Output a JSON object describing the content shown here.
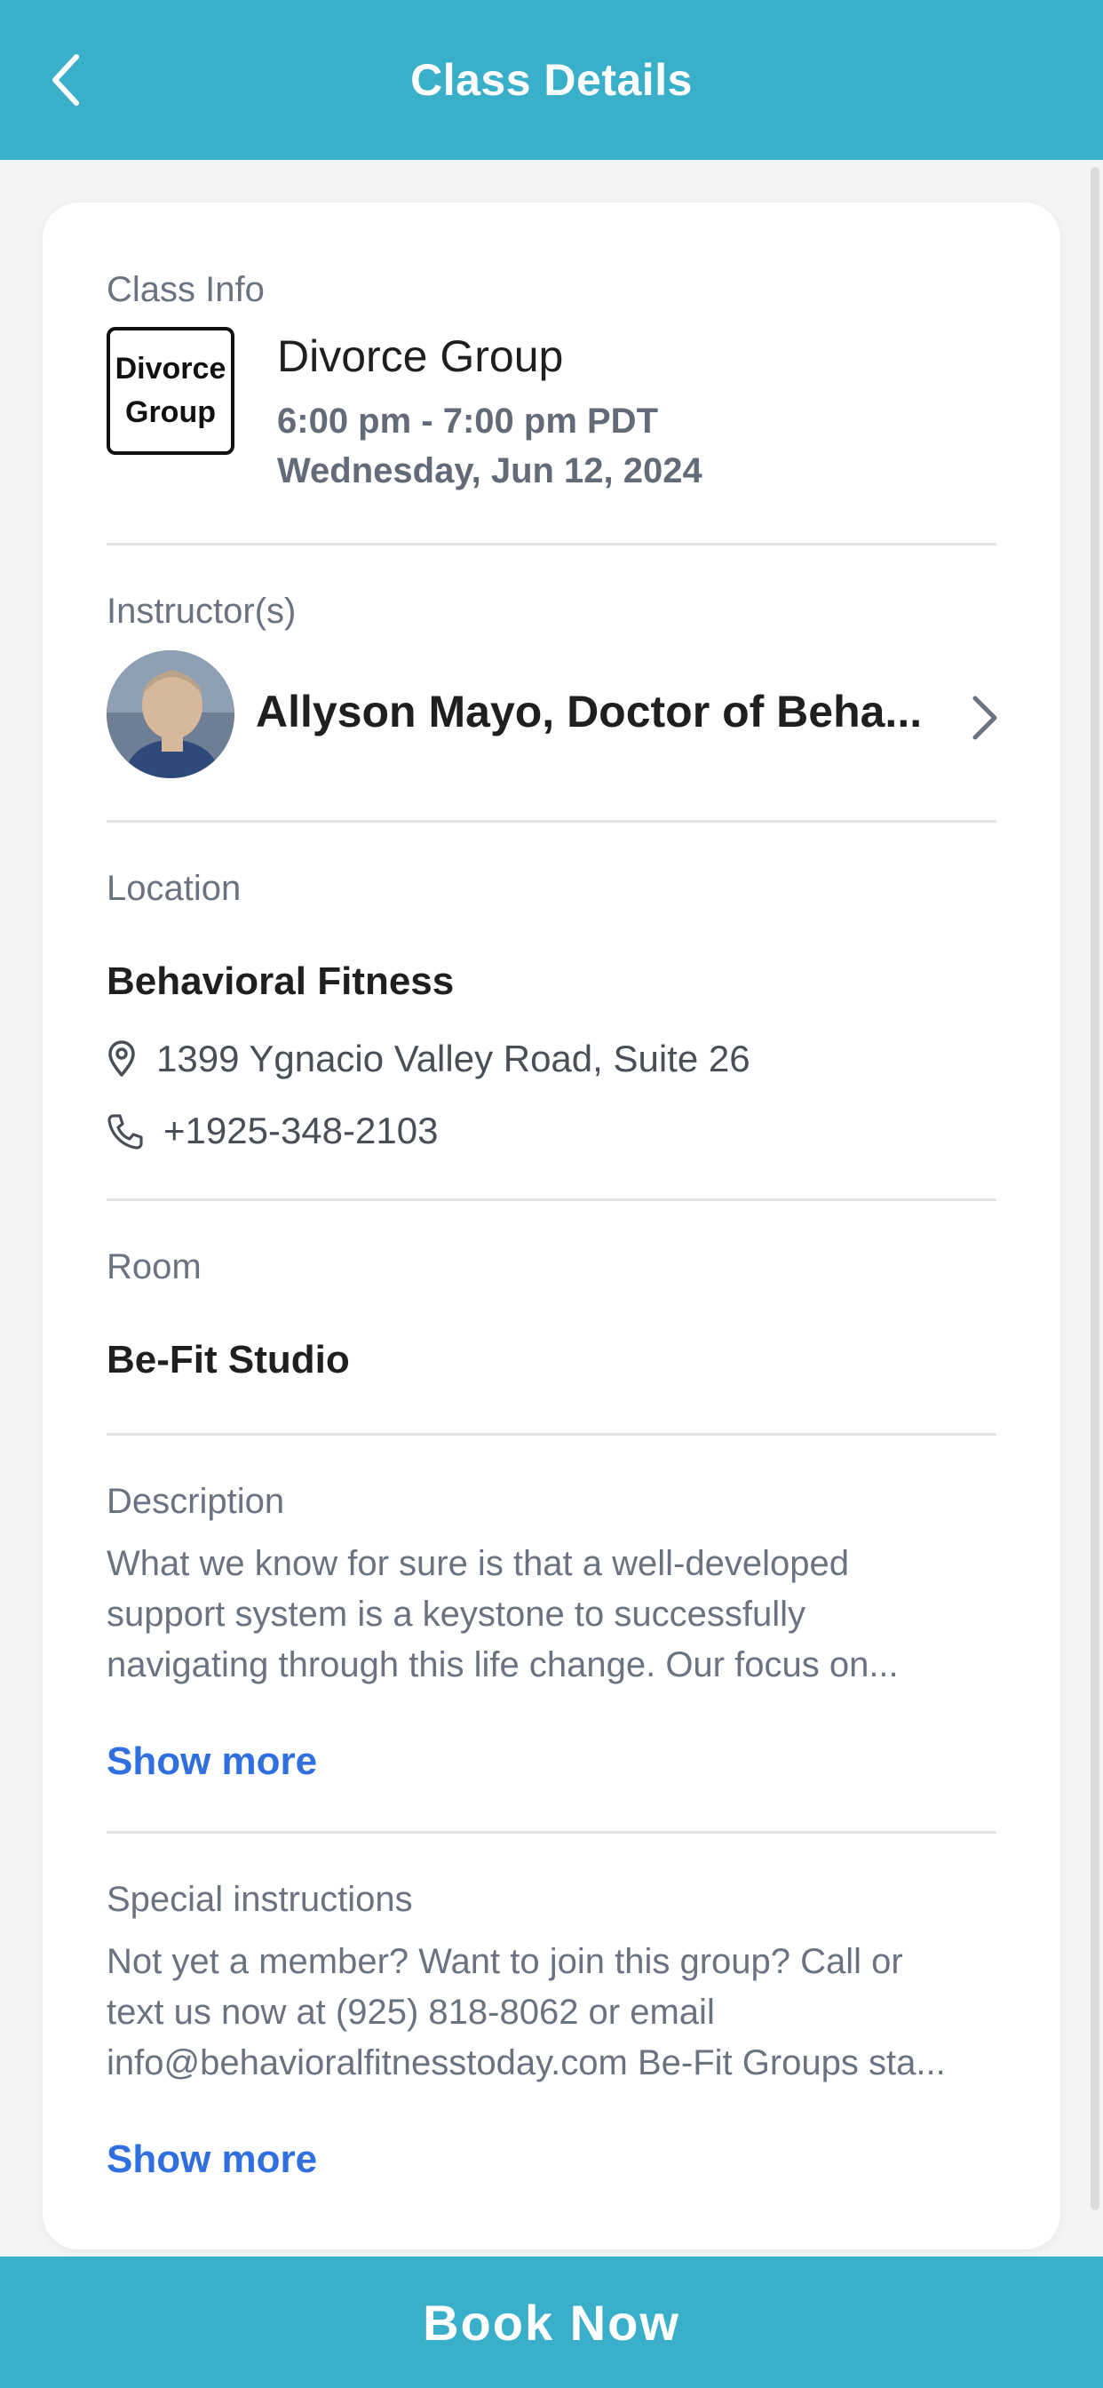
{
  "header": {
    "title": "Class Details"
  },
  "class_info": {
    "label": "Class Info",
    "thumb_text": "Divorce\nGroup",
    "name": "Divorce Group",
    "time": "6:00 pm - 7:00 pm PDT",
    "date": "Wednesday, Jun 12, 2024"
  },
  "instructors": {
    "label": "Instructor(s)",
    "name": "Allyson Mayo, Doctor of Beha..."
  },
  "location": {
    "label": "Location",
    "name": "Behavioral Fitness",
    "address": "1399 Ygnacio Valley Road, Suite 26",
    "phone": "+1925-348-2103"
  },
  "room": {
    "label": "Room",
    "name": "Be-Fit Studio"
  },
  "description": {
    "label": "Description",
    "lines": [
      "What we know for sure is that a well-developed",
      "support system is a keystone to successfully",
      "navigating through this life change. Our focus on..."
    ],
    "show_more": "Show more"
  },
  "special_instructions": {
    "label": "Special instructions",
    "lines": [
      "Not yet a member? Want to join this group? Call or",
      "text us now at (925) 818-8062 or email",
      "info@behavioralfitnesstoday.com Be-Fit Groups sta..."
    ],
    "show_more": "Show more"
  },
  "footer": {
    "book_label": "Book Now"
  },
  "colors": {
    "accent": "#3aafc9",
    "link": "#2f6fe0"
  },
  "icons": {
    "back": "chevron-left-icon",
    "instructor_more": "chevron-right-icon",
    "address": "map-pin-icon",
    "phone": "phone-icon"
  }
}
